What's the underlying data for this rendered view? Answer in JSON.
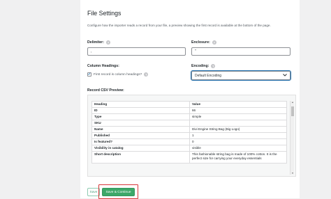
{
  "settings": {
    "title": "File Settings",
    "description": "Configure how the importer reads a record from your file, a preview showing the first record is available at the bottom of the page.",
    "help_glyph": "?",
    "delimiter": {
      "label": "Delimiter:",
      "value": ","
    },
    "enclosure": {
      "label": "Enclosure:",
      "value": "\""
    },
    "column_headings": {
      "label": "Column Headings:",
      "checkbox_label": "First record is column headings?",
      "checked": true
    },
    "encoding": {
      "label": "Encoding:",
      "value": "Default Encoding"
    }
  },
  "preview": {
    "label": "Record CSV Preview:",
    "headers": [
      "Heading",
      "Value"
    ],
    "rows": [
      [
        "ID",
        "66"
      ],
      [
        "Type",
        "simple"
      ],
      [
        "SKU",
        ""
      ],
      [
        "Name",
        "Divi Engine String Bag (Big Logo)"
      ],
      [
        "Published",
        "1"
      ],
      [
        "Is featured?",
        "0"
      ],
      [
        "Visibility in catalog",
        "visible"
      ],
      [
        "Short description",
        "This fashionable string bag is made of 100% cotton. It is the perfect size for carrying your everyday essentials"
      ]
    ]
  },
  "actions": {
    "save_label": "Save",
    "continue_label": "Save & Continue",
    "highlight_color": "#d63638",
    "accent_color": "#3da869"
  }
}
